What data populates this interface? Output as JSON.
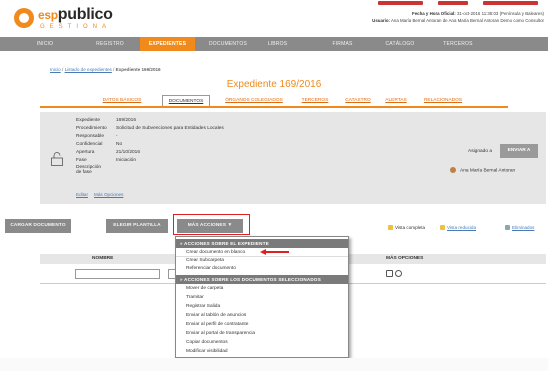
{
  "header": {
    "logo_prefix": "esp",
    "logo_main": "publico",
    "logo_sub": "GESTIONA",
    "fecha_label": "Fecha y Hora Oficial:",
    "fecha_value": "31-oct-2016 11:35:03 (Península y Baleares)",
    "usuario_label": "Usuario:",
    "usuario_value": "Ana María Bernal Antoran de Ana María Bernal Antoran Demo como Consultor"
  },
  "nav": {
    "items": [
      "INICIO",
      "REGISTRO",
      "EXPEDIENTES",
      "DOCUMENTOS",
      "LIBROS",
      "FIRMAS",
      "CATÁLOGO",
      "TERCEROS"
    ]
  },
  "breadcrumb": {
    "inicio": "Inicio",
    "sep1": " / ",
    "listado": "Listado de expedientes",
    "sep2": " / ",
    "current": "Expediente 169/2016"
  },
  "page_title": "Expediente 169/2016",
  "tabs": [
    "DATOS BÁSICOS",
    "DOCUMENTOS",
    "ÓRGANOS COLEGIADOS",
    "TERCEROS",
    "CATASTRO",
    "ALERTAS",
    "RELACIONADOS"
  ],
  "info": {
    "rows": [
      {
        "label": "Expediente",
        "value": "169/2016"
      },
      {
        "label": "Procedimiento",
        "value": "Solicitud de Subvenciones para Entidades Locales"
      },
      {
        "label": "Responsable",
        "value": "-"
      },
      {
        "label": "Confidencial",
        "value": "No"
      },
      {
        "label": "Apertura",
        "value": "21/10/2016"
      },
      {
        "label": "Fase",
        "value": "Iniciación"
      },
      {
        "label": "Descripción de fase",
        "value": ""
      }
    ],
    "link_editar": "Editar",
    "link_mas": "Más Opciones",
    "asignado_label": "Asignado a",
    "enviar_label": "ENVIAR A",
    "user_name": "Ana María Bernal Antoran"
  },
  "buttons": {
    "cargar": "CARGAR DOCUMENTO",
    "elegir": "ELEGIR PLANTILLA",
    "mas": "MÁS ACCIONES ▼"
  },
  "views": {
    "completa": "Vista completa",
    "reducida": "Vista reducida",
    "eliminados": "Eliminados"
  },
  "table": {
    "col_nombre": "NOMBRE",
    "col_mas": "MÁS OPCIONES"
  },
  "dropdown": {
    "header1": "» ACCIONES SOBRE EL EXPEDIENTE",
    "group1": [
      "Crear documento en blanco",
      "Crear Subcarpeta",
      "Referenciar documento"
    ],
    "header2": "» ACCIONES SOBRE LOS DOCUMENTOS SELECCIONADOS",
    "group2": [
      "Mover de carpeta",
      "Tramitar",
      "Registrar Salida",
      "Enviar al tablón de anuncios",
      "Enviar al perfil de contratante",
      "Enviar al portal de transparencia",
      "Copiar documentos",
      "Modificar visibilidad"
    ]
  },
  "colors": {
    "accent": "#f08a1c",
    "nav_bg": "#8a8a8a",
    "highlight": "#e02020"
  }
}
